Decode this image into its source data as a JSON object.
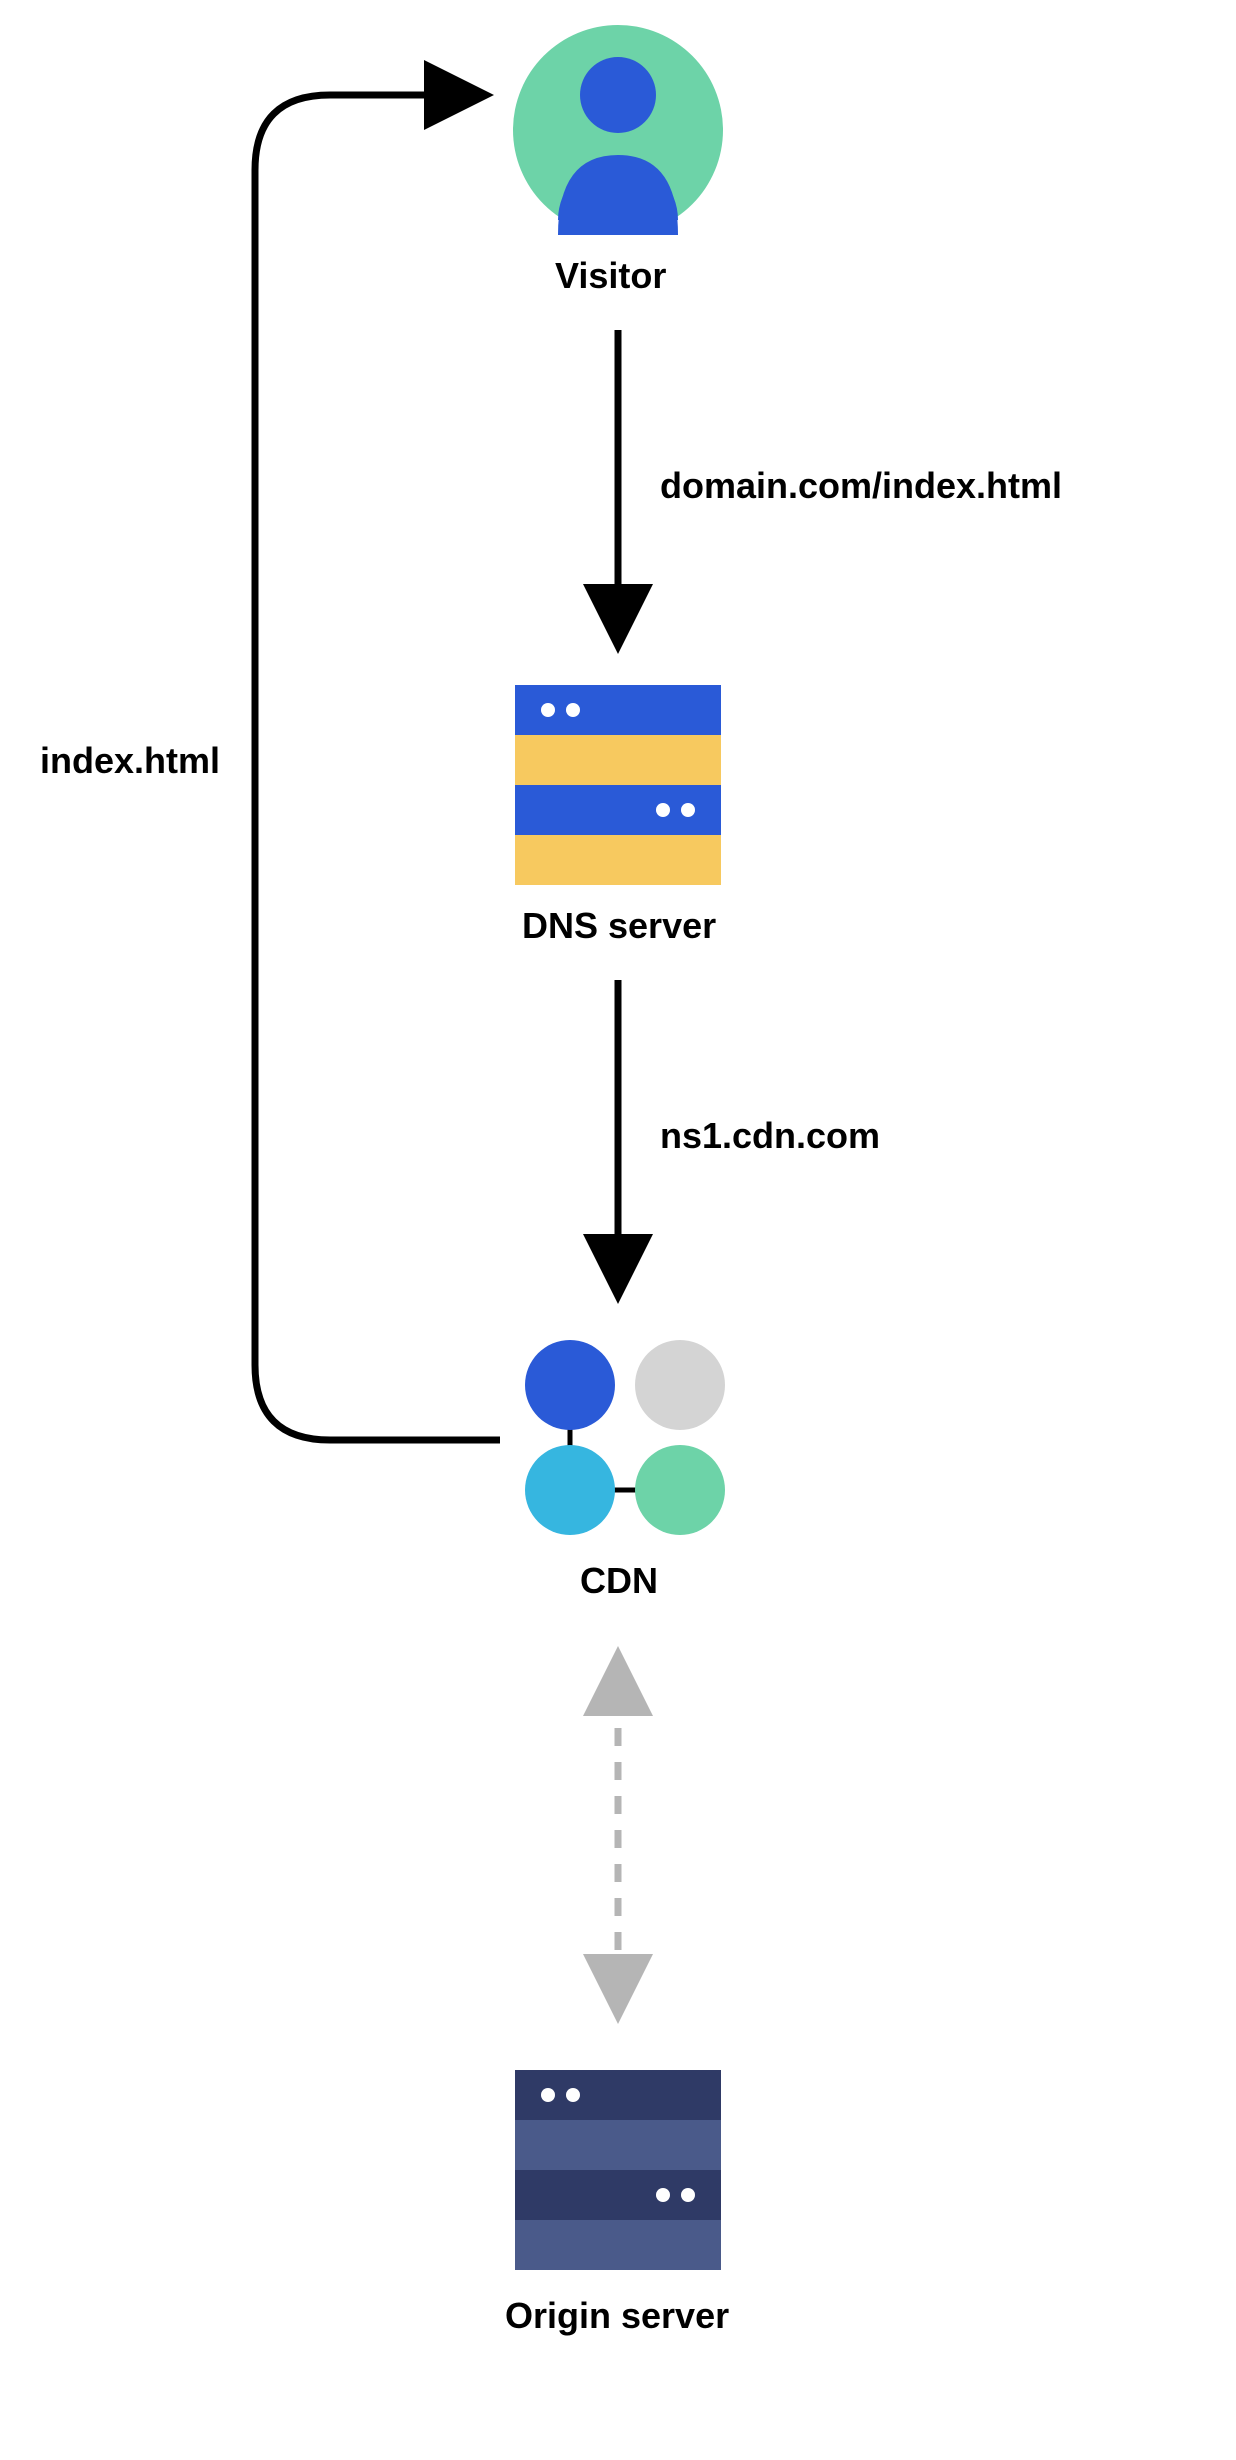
{
  "nodes": {
    "visitor": {
      "label": "Visitor"
    },
    "dns": {
      "label": "DNS server"
    },
    "cdn": {
      "label": "CDN"
    },
    "origin": {
      "label": "Origin server"
    }
  },
  "edges": {
    "visitor_to_dns": {
      "label": "domain.com/index.html"
    },
    "dns_to_cdn": {
      "label": "ns1.cdn.com"
    },
    "cdn_to_visitor": {
      "label": "index.html"
    }
  },
  "colors": {
    "mint": "#6dd3a8",
    "blue": "#2a5ad7",
    "yellow": "#f7c95f",
    "cyan": "#36b6e0",
    "grey": "#d4d4d4",
    "navy": "#2f3a66",
    "slate": "#4a5a8a",
    "arrow_grey": "#b5b5b5"
  }
}
